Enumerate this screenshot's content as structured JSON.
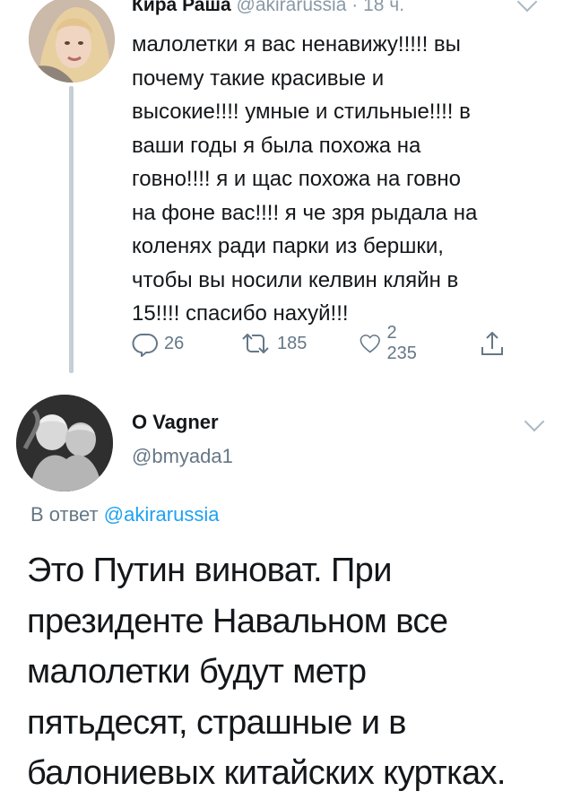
{
  "tweet_parent": {
    "display_name": "Кира Раша",
    "handle": "@akirarussia",
    "separator": "·",
    "time": "18 ч.",
    "text": "малолетки я вас ненавижу!!!!! вы\nпочему такие красивые и\nвысокие!!!! умные и стильные!!!! в\nваши годы я была похожа на\nговно!!!! я и щас похожа на говно\nна фоне вас!!!! я че зря рыдала на\nколенях ради парки из бершки,\nчтобы вы носили келвин кляйн в\n15!!!! спасибо нахуй!!!",
    "actions": {
      "reply_count": "26",
      "retweet_count": "185",
      "like_count": "2 235"
    }
  },
  "tweet_reply": {
    "display_name": "О Vagner",
    "handle": "@bmyada1",
    "reply_prefix": "В ответ",
    "reply_mention": "@akirarussia",
    "text": "Это Путин виноват. При\nпрезиденте Навальном все\nмалолетки будут метр\nпятьдесят, страшные и в\nбалониевых китайских куртках."
  },
  "colors": {
    "text": "#14171a",
    "secondary": "#657786",
    "link": "#1da1f2",
    "thread_line": "#c4cfd6"
  },
  "icons": {
    "reply": "reply-icon",
    "retweet": "retweet-icon",
    "like": "heart-icon",
    "share": "share-icon",
    "menu": "chevron-down-icon"
  }
}
